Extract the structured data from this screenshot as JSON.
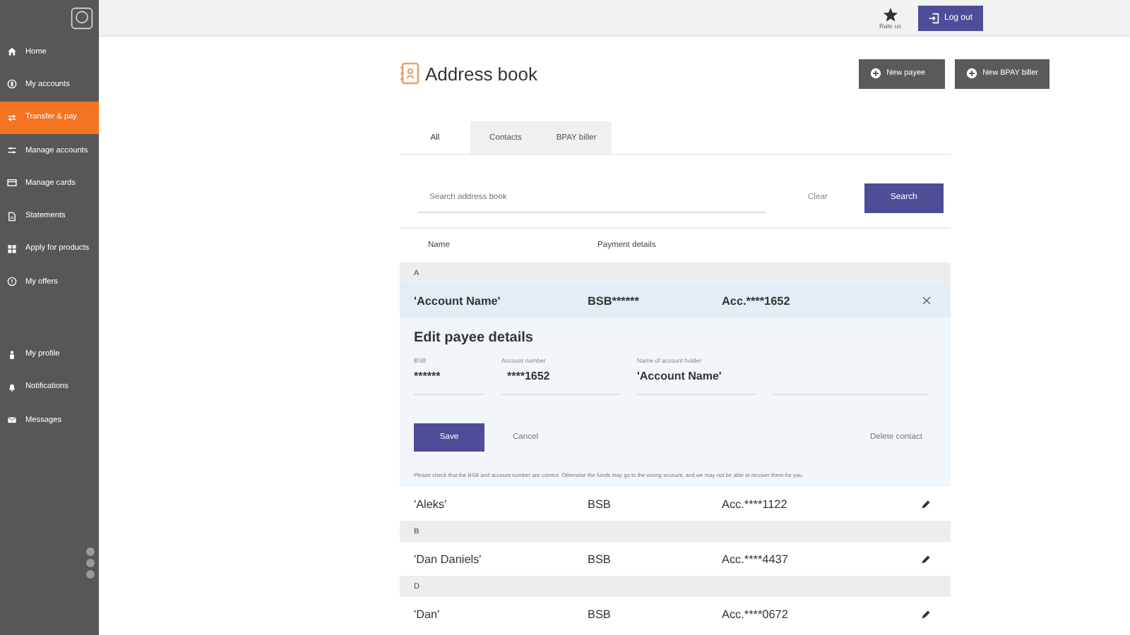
{
  "sidebar": {
    "items": [
      {
        "label": "Home",
        "selected": false
      },
      {
        "label": "My accounts",
        "selected": false
      },
      {
        "label": "Transfer & pay",
        "selected": true
      },
      {
        "label": "Manage accounts",
        "selected": false
      },
      {
        "label": "Manage cards",
        "selected": false
      },
      {
        "label": "Statements",
        "selected": false
      },
      {
        "label": "Apply for products",
        "selected": false
      },
      {
        "label": "My offers",
        "selected": false
      }
    ],
    "secondary_items": [
      {
        "label": "My profile",
        "selected": false
      },
      {
        "label": "Notifications",
        "selected": false
      },
      {
        "label": "Messages",
        "selected": false
      }
    ]
  },
  "header": {
    "rate_label": "Rate us",
    "logout_button": "Log out"
  },
  "page": {
    "title": "Address book",
    "actions": [
      "New payee",
      "New BPAY biller"
    ]
  },
  "tabs": [
    {
      "label": "All",
      "selected": true
    },
    {
      "label": "Contacts",
      "selected": false
    },
    {
      "label": "BPAY biller",
      "selected": false
    }
  ],
  "search": {
    "placeholder": "Search address book",
    "clear": "Clear",
    "button": "Search"
  },
  "table": {
    "columns": [
      "Name",
      "Payment details"
    ],
    "groups": [
      {
        "letter": "A",
        "rows": [
          {
            "name": "'Account Name'",
            "bsb": "BSB******",
            "account": "Acc.****1652",
            "expanded": true
          },
          {
            "name": "'Aleks'",
            "bsb": "BSB",
            "account": "Acc.****1122",
            "expanded": false
          }
        ]
      },
      {
        "letter": "B",
        "rows": [
          {
            "name": "'Dan Daniels'",
            "bsb": "BSB",
            "account": "Acc.****4437",
            "expanded": false
          }
        ]
      },
      {
        "letter": "D",
        "rows": [
          {
            "name": "'Dan'",
            "bsb": "BSB",
            "account": "Acc.****0672",
            "expanded": false
          }
        ]
      }
    ]
  },
  "edit_panel": {
    "title": "Edit payee details",
    "fields": [
      {
        "label": "BSB",
        "value": "******"
      },
      {
        "label": "Account number",
        "value": "****1652"
      },
      {
        "label": "Name of account holder",
        "value": "'Account Name'"
      }
    ],
    "save": "Save",
    "cancel": "Cancel",
    "delete": "Delete contact",
    "notice": "Please check that the BSB and account number are correct. Otherwise the funds may go to the wrong account, and we may not be able to recover them for you."
  }
}
